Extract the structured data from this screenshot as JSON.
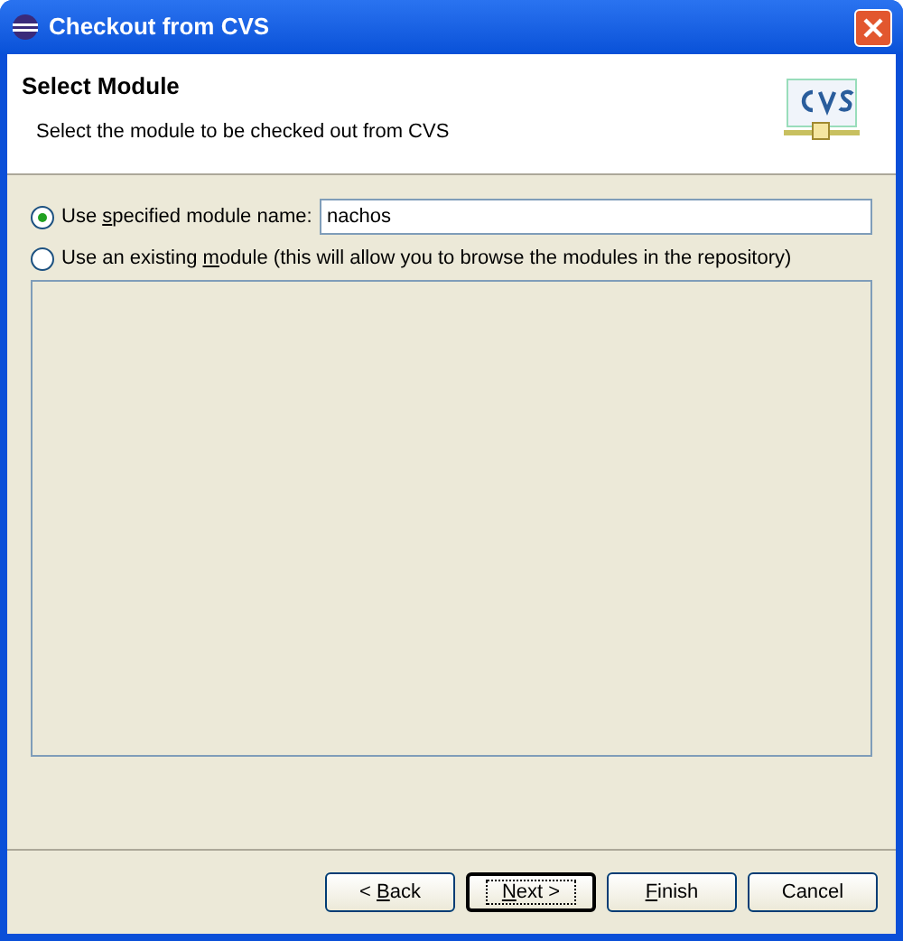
{
  "window": {
    "title": "Checkout from CVS"
  },
  "header": {
    "title": "Select Module",
    "description": "Select the module to be checked out from CVS"
  },
  "options": [
    {
      "label": {
        "before": "Use ",
        "key": "s",
        "after": "pecified module name:"
      },
      "selected": true,
      "kind": "text",
      "value": "nachos"
    },
    {
      "label": {
        "before": "Use an existing ",
        "key": "m",
        "after": "odule (this will allow you to browse the modules in the repository)"
      },
      "selected": false,
      "kind": "list"
    }
  ],
  "buttons": [
    {
      "label": {
        "before": "< ",
        "key": "B",
        "after": "ack"
      },
      "default": false
    },
    {
      "label": {
        "key": "N",
        "after": "ext >"
      },
      "default": true
    },
    {
      "label": {
        "key": "F",
        "after": "inish"
      },
      "default": false
    },
    {
      "label": {
        "before": "Cancel"
      },
      "default": false
    }
  ]
}
